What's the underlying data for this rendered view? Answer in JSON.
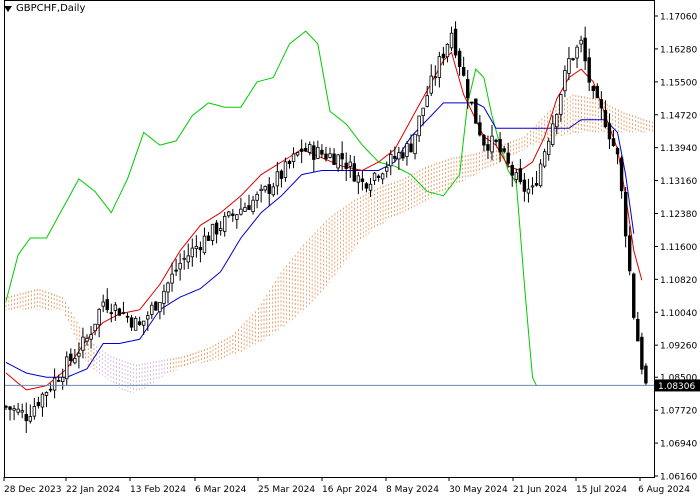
{
  "window": {
    "symbol_title": "GBPCHF,Daily"
  },
  "colors": {
    "background": "#ffffff",
    "axis": "#000000",
    "candles": "#000000",
    "tenkan": "#dd0000",
    "kijun": "#0000cc",
    "chikou": "#00cc00",
    "cloud_a": "#e07a30",
    "cloud_b": "#c8a0d8",
    "price_line": "#6a8ab0",
    "price_label_bg": "#000000",
    "price_label_fg": "#ffffff"
  },
  "chart_data": {
    "type": "candlestick",
    "symbol": "GBPCHF",
    "timeframe": "Daily",
    "current_price": "1.08306",
    "ylim": [
      1.0616,
      1.1706
    ],
    "y_ticks": [
      "1.17060",
      "1.16280",
      "1.15500",
      "1.14720",
      "1.13940",
      "1.13160",
      "1.12380",
      "1.11600",
      "1.10820",
      "1.10040",
      "1.09260",
      "1.08500",
      "1.07720",
      "1.06940",
      "1.06160"
    ],
    "x_ticks": [
      "28 Dec 2023",
      "22 Jan 2024",
      "13 Feb 2024",
      "6 Mar 2024",
      "25 Mar 2024",
      "16 Apr 2024",
      "8 May 2024",
      "30 May 2024",
      "21 Jun 2024",
      "15 Jul 2024",
      "6 Aug 2024"
    ],
    "close_anchors": [
      [
        0,
        1.078
      ],
      [
        5,
        1.076
      ],
      [
        10,
        1.082
      ],
      [
        15,
        1.088
      ],
      [
        20,
        1.094
      ],
      [
        24,
        1.103
      ],
      [
        28,
        1.101
      ],
      [
        33,
        1.097
      ],
      [
        38,
        1.104
      ],
      [
        43,
        1.112
      ],
      [
        48,
        1.117
      ],
      [
        53,
        1.121
      ],
      [
        58,
        1.125
      ],
      [
        63,
        1.128
      ],
      [
        68,
        1.133
      ],
      [
        73,
        1.139
      ],
      [
        78,
        1.138
      ],
      [
        83,
        1.137
      ],
      [
        88,
        1.131
      ],
      [
        92,
        1.134
      ],
      [
        96,
        1.137
      ],
      [
        100,
        1.14
      ],
      [
        104,
        1.152
      ],
      [
        108,
        1.162
      ],
      [
        110,
        1.167
      ],
      [
        113,
        1.156
      ],
      [
        116,
        1.146
      ],
      [
        118,
        1.141
      ],
      [
        121,
        1.14
      ],
      [
        124,
        1.135
      ],
      [
        127,
        1.13
      ],
      [
        130,
        1.129
      ],
      [
        133,
        1.139
      ],
      [
        136,
        1.149
      ],
      [
        139,
        1.16
      ],
      [
        142,
        1.164
      ],
      [
        145,
        1.151
      ],
      [
        148,
        1.146
      ],
      [
        151,
        1.137
      ],
      [
        153,
        1.12
      ],
      [
        155,
        1.1
      ],
      [
        157,
        1.088
      ],
      [
        158,
        1.083
      ]
    ],
    "tenkan": [
      [
        0,
        1.086
      ],
      [
        5,
        1.082
      ],
      [
        10,
        1.083
      ],
      [
        15,
        1.087
      ],
      [
        20,
        1.094
      ],
      [
        24,
        1.098
      ],
      [
        28,
        1.1
      ],
      [
        33,
        1.101
      ],
      [
        38,
        1.107
      ],
      [
        43,
        1.115
      ],
      [
        48,
        1.121
      ],
      [
        53,
        1.124
      ],
      [
        58,
        1.128
      ],
      [
        63,
        1.133
      ],
      [
        68,
        1.136
      ],
      [
        73,
        1.139
      ],
      [
        78,
        1.137
      ],
      [
        83,
        1.135
      ],
      [
        88,
        1.134
      ],
      [
        92,
        1.136
      ],
      [
        96,
        1.139
      ],
      [
        100,
        1.146
      ],
      [
        104,
        1.153
      ],
      [
        108,
        1.16
      ],
      [
        110,
        1.162
      ],
      [
        113,
        1.152
      ],
      [
        116,
        1.146
      ],
      [
        118,
        1.142
      ],
      [
        121,
        1.14
      ],
      [
        124,
        1.135
      ],
      [
        127,
        1.134
      ],
      [
        130,
        1.136
      ],
      [
        133,
        1.142
      ],
      [
        136,
        1.151
      ],
      [
        139,
        1.156
      ],
      [
        142,
        1.158
      ],
      [
        145,
        1.155
      ],
      [
        148,
        1.147
      ],
      [
        151,
        1.139
      ],
      [
        153,
        1.128
      ],
      [
        155,
        1.115
      ],
      [
        157,
        1.108
      ]
    ],
    "kijun": [
      [
        0,
        1.0885
      ],
      [
        5,
        1.086
      ],
      [
        10,
        1.085
      ],
      [
        15,
        1.085
      ],
      [
        20,
        1.087
      ],
      [
        24,
        1.093
      ],
      [
        28,
        1.093
      ],
      [
        33,
        1.094
      ],
      [
        38,
        1.101
      ],
      [
        43,
        1.104
      ],
      [
        48,
        1.106
      ],
      [
        53,
        1.11
      ],
      [
        58,
        1.118
      ],
      [
        63,
        1.124
      ],
      [
        68,
        1.128
      ],
      [
        73,
        1.133
      ],
      [
        78,
        1.134
      ],
      [
        83,
        1.134
      ],
      [
        88,
        1.134
      ],
      [
        92,
        1.134
      ],
      [
        96,
        1.136
      ],
      [
        100,
        1.142
      ],
      [
        104,
        1.146
      ],
      [
        108,
        1.15
      ],
      [
        110,
        1.15
      ],
      [
        113,
        1.15
      ],
      [
        116,
        1.15
      ],
      [
        118,
        1.149
      ],
      [
        121,
        1.144
      ],
      [
        124,
        1.144
      ],
      [
        127,
        1.144
      ],
      [
        130,
        1.144
      ],
      [
        133,
        1.144
      ],
      [
        136,
        1.144
      ],
      [
        139,
        1.144
      ],
      [
        142,
        1.146
      ],
      [
        145,
        1.146
      ],
      [
        148,
        1.146
      ],
      [
        151,
        1.143
      ],
      [
        153,
        1.133
      ],
      [
        155,
        1.119
      ]
    ],
    "chikou": [
      [
        0,
        1.103
      ],
      [
        3,
        1.114
      ],
      [
        6,
        1.118
      ],
      [
        10,
        1.118
      ],
      [
        14,
        1.125
      ],
      [
        18,
        1.132
      ],
      [
        22,
        1.129
      ],
      [
        26,
        1.124
      ],
      [
        30,
        1.132
      ],
      [
        34,
        1.143
      ],
      [
        38,
        1.14
      ],
      [
        42,
        1.141
      ],
      [
        46,
        1.147
      ],
      [
        50,
        1.15
      ],
      [
        54,
        1.149
      ],
      [
        58,
        1.149
      ],
      [
        62,
        1.155
      ],
      [
        66,
        1.156
      ],
      [
        70,
        1.164
      ],
      [
        74,
        1.167
      ],
      [
        77,
        1.164
      ],
      [
        80,
        1.148
      ],
      [
        84,
        1.145
      ],
      [
        88,
        1.14
      ],
      [
        92,
        1.136
      ],
      [
        96,
        1.135
      ],
      [
        100,
        1.133
      ],
      [
        104,
        1.129
      ],
      [
        108,
        1.128
      ],
      [
        112,
        1.133
      ],
      [
        114,
        1.15
      ],
      [
        116,
        1.158
      ],
      [
        118,
        1.156
      ],
      [
        120,
        1.147
      ],
      [
        122,
        1.14
      ],
      [
        124,
        1.134
      ],
      [
        126,
        1.131
      ],
      [
        128,
        1.107
      ],
      [
        130,
        1.085
      ],
      [
        131,
        1.083
      ]
    ],
    "cloud_top": [
      [
        0,
        1.104
      ],
      [
        8,
        1.106
      ],
      [
        14,
        1.104
      ],
      [
        20,
        1.094
      ],
      [
        26,
        1.09
      ],
      [
        32,
        1.088
      ],
      [
        38,
        1.089
      ],
      [
        44,
        1.09
      ],
      [
        50,
        1.092
      ],
      [
        56,
        1.095
      ],
      [
        62,
        1.101
      ],
      [
        68,
        1.11
      ],
      [
        74,
        1.117
      ],
      [
        80,
        1.123
      ],
      [
        86,
        1.127
      ],
      [
        92,
        1.13
      ],
      [
        98,
        1.132
      ],
      [
        104,
        1.135
      ],
      [
        110,
        1.137
      ],
      [
        116,
        1.138
      ],
      [
        122,
        1.14
      ],
      [
        128,
        1.142
      ],
      [
        134,
        1.148
      ],
      [
        140,
        1.152
      ],
      [
        146,
        1.151
      ],
      [
        152,
        1.148
      ],
      [
        158,
        1.146
      ],
      [
        162,
        1.145
      ]
    ],
    "cloud_bottom": [
      [
        0,
        1.101
      ],
      [
        8,
        1.101
      ],
      [
        14,
        1.101
      ],
      [
        20,
        1.088
      ],
      [
        26,
        1.084
      ],
      [
        30,
        1.081
      ],
      [
        34,
        1.082
      ],
      [
        40,
        1.086
      ],
      [
        46,
        1.088
      ],
      [
        52,
        1.089
      ],
      [
        58,
        1.091
      ],
      [
        64,
        1.094
      ],
      [
        70,
        1.098
      ],
      [
        76,
        1.103
      ],
      [
        82,
        1.11
      ],
      [
        88,
        1.118
      ],
      [
        94,
        1.122
      ],
      [
        100,
        1.125
      ],
      [
        106,
        1.128
      ],
      [
        112,
        1.131
      ],
      [
        118,
        1.134
      ],
      [
        124,
        1.137
      ],
      [
        130,
        1.14
      ],
      [
        136,
        1.142
      ],
      [
        142,
        1.143
      ],
      [
        148,
        1.143
      ],
      [
        154,
        1.143
      ],
      [
        162,
        1.143
      ]
    ]
  }
}
